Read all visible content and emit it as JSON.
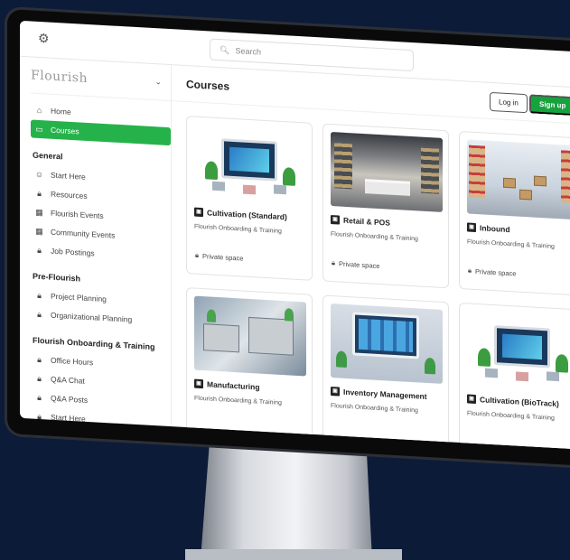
{
  "topbar": {
    "search_placeholder": "Search"
  },
  "sidebar": {
    "logo": "Flourish",
    "top_items": [
      {
        "label": "Home",
        "icon": "home-icon"
      },
      {
        "label": "Courses",
        "icon": "book-icon",
        "active": true
      }
    ],
    "sections": [
      {
        "title": "General",
        "items": [
          {
            "label": "Start Here",
            "icon": "avatar-icon"
          },
          {
            "label": "Resources",
            "icon": "lock-icon"
          },
          {
            "label": "Flourish Events",
            "icon": "calendar-icon"
          },
          {
            "label": "Community Events",
            "icon": "calendar-icon"
          },
          {
            "label": "Job Postings",
            "icon": "lock-icon"
          }
        ]
      },
      {
        "title": "Pre-Flourish",
        "items": [
          {
            "label": "Project Planning",
            "icon": "lock-icon"
          },
          {
            "label": "Organizational Planning",
            "icon": "lock-icon"
          }
        ]
      },
      {
        "title": "Flourish Onboarding & Training",
        "items": [
          {
            "label": "Office Hours",
            "icon": "lock-icon"
          },
          {
            "label": "Q&A Chat",
            "icon": "lock-icon"
          },
          {
            "label": "Q&A Posts",
            "icon": "lock-icon"
          },
          {
            "label": "Start Here",
            "icon": "lock-icon"
          }
        ]
      }
    ]
  },
  "main": {
    "title": "Courses",
    "login_label": "Log in",
    "signup_label": "Sign up",
    "cards": [
      {
        "title": "Cultivation (Standard)",
        "subtitle": "Flourish Onboarding & Training",
        "private": "Private space",
        "thumb": "t-cult"
      },
      {
        "title": "Retail & POS",
        "subtitle": "Flourish Onboarding & Training",
        "private": "Private space",
        "thumb": "t-retail"
      },
      {
        "title": "Inbound",
        "subtitle": "Flourish Onboarding & Training",
        "private": "Private space",
        "thumb": "t-inbound"
      },
      {
        "title": "Manufacturing",
        "subtitle": "Flourish Onboarding & Training",
        "private": "",
        "thumb": "t-manu"
      },
      {
        "title": "Inventory Management",
        "subtitle": "Flourish Onboarding & Training",
        "private": "",
        "thumb": "t-inv"
      },
      {
        "title": "Cultivation (BioTrack)",
        "subtitle": "Flourish Onboarding & Training",
        "private": "",
        "thumb": "t-cult"
      }
    ]
  },
  "colors": {
    "accent": "#26b24a",
    "signup": "#16a33d",
    "background": "#0c1b38"
  }
}
